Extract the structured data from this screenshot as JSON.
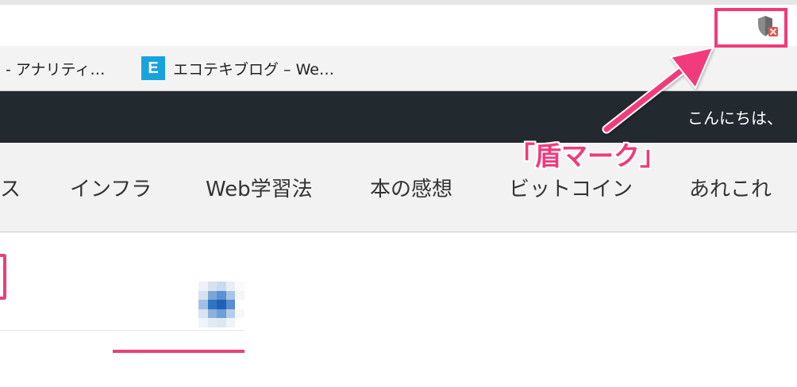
{
  "browser": {
    "bookmarks": [
      {
        "label": "- アナリティ…",
        "favicon": ""
      },
      {
        "label": "エコテキブログ – We…",
        "favicon": "E"
      }
    ]
  },
  "site": {
    "greeting": "こんにちは、",
    "nav": [
      "ス",
      "インフラ",
      "Web学習法",
      "本の感想",
      "ビットコイン",
      "あれこれ"
    ]
  },
  "annotation": {
    "label": "「盾マーク」",
    "icon": "shield-x-icon",
    "color": "#f23a7b"
  },
  "colors": {
    "accent_pink": "#ea3f7a",
    "header_dark": "#22292f",
    "favicon_blue": "#19a3dd"
  }
}
